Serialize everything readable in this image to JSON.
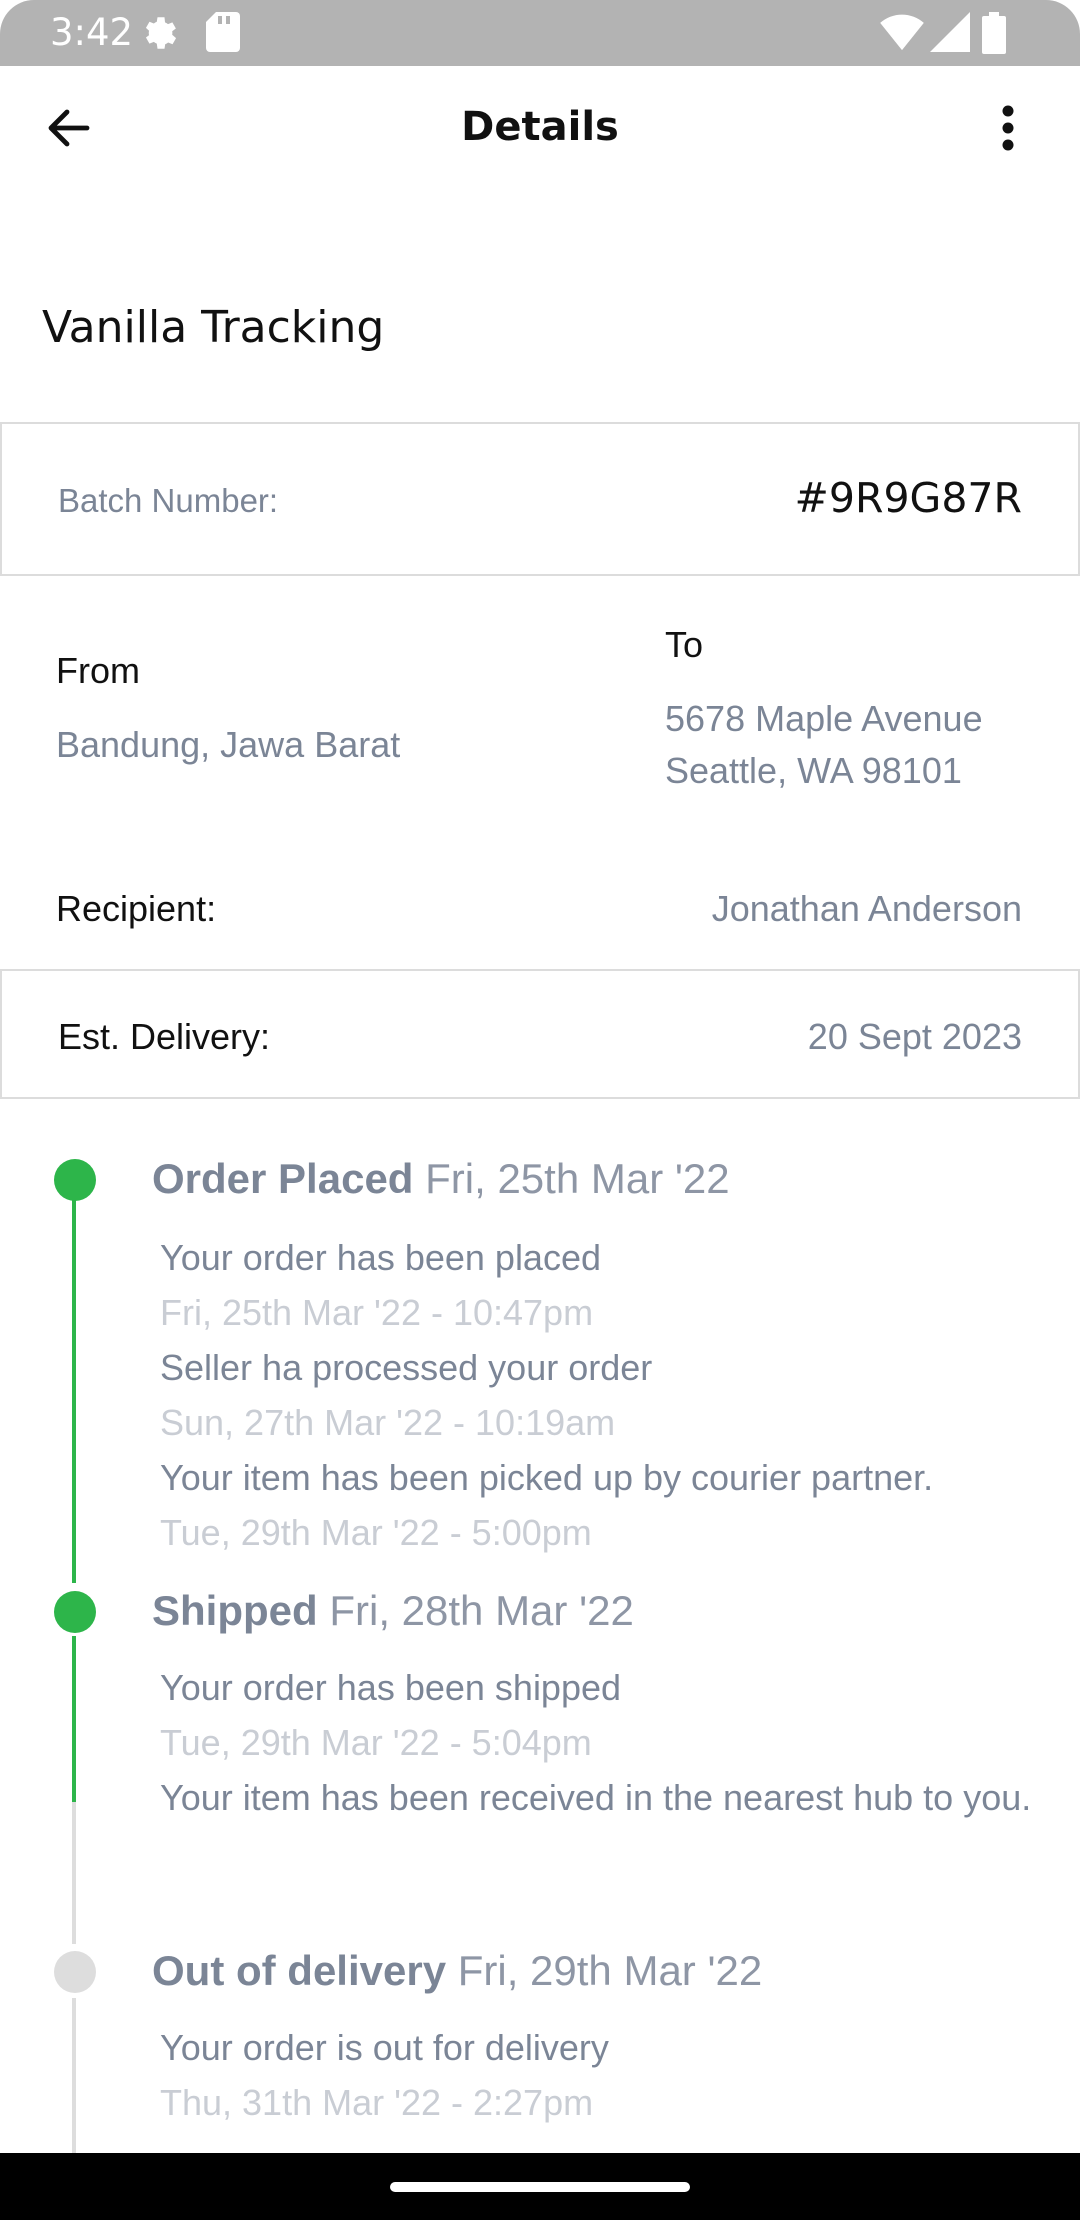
{
  "status_bar": {
    "time": "3:42",
    "icons": [
      "settings-gear-icon",
      "sd-card-icon",
      "wifi-icon",
      "signal-icon",
      "battery-icon"
    ]
  },
  "app_bar": {
    "title": "Details",
    "back_icon": "arrow-left-icon",
    "more_icon": "more-vertical-icon"
  },
  "product": {
    "name": "Vanilla Tracking"
  },
  "batch": {
    "label": "Batch Number:",
    "value": "#9R9G87R"
  },
  "route": {
    "from_label": "From",
    "from_value": "Bandung, Jawa Barat",
    "to_label": "To",
    "to_lines": [
      "5678 Maple Avenue",
      "Seattle, WA 98101"
    ]
  },
  "recipient": {
    "label": "Recipient:",
    "value": "Jonathan Anderson"
  },
  "delivery": {
    "label": "Est. Delivery:",
    "value": "20 Sept 2023"
  },
  "colors": {
    "active": "#2db54a",
    "inactive": "#dddddd",
    "muted_text": "#7b8596",
    "faint_text": "#c9cdd4"
  },
  "timeline": [
    {
      "name": "Order Placed",
      "date": "Fri, 25th Mar '22",
      "completed": true,
      "events": [
        {
          "text": "Your order has been placed",
          "time": "Fri, 25th Mar '22 - 10:47pm"
        },
        {
          "text": "Seller ha processed your order",
          "time": "Sun, 27th Mar '22 - 10:19am"
        },
        {
          "text": "Your item has been picked up by courier partner.",
          "time": "Tue, 29th Mar '22 - 5:00pm"
        }
      ]
    },
    {
      "name": "Shipped",
      "date": "Fri, 28th Mar '22",
      "completed": true,
      "events": [
        {
          "text": "Your order has been shipped",
          "time": "Tue, 29th Mar '22 - 5:04pm"
        },
        {
          "text": "Your item has been received in the nearest hub to you.",
          "time": ""
        }
      ]
    },
    {
      "name": "Out of delivery",
      "date": "Fri, 29th Mar '22",
      "completed": false,
      "events": [
        {
          "text": "Your order is out for delivery",
          "time": "Thu, 31th Mar '22 - 2:27pm"
        }
      ]
    }
  ]
}
